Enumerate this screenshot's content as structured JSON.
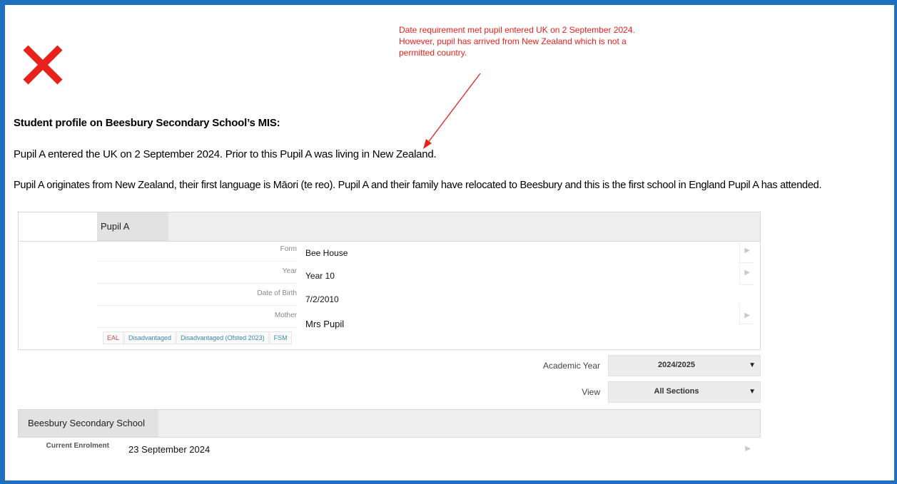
{
  "annotation": {
    "lines": [
      "Date requirement met pupil entered UK on 2 September 2024.",
      "However, pupil has arrived from New Zealand which is not a",
      "permitted country."
    ]
  },
  "icons": {
    "mark": "cross-icon",
    "row_arrow": "chevron-right-icon",
    "dropdown": "caret-down-icon"
  },
  "colors": {
    "cross": "#e8211d",
    "frame": "#1f6fbf",
    "annotation": "#e8211d"
  },
  "heading": "Student profile on Beesbury Secondary School’s MIS:",
  "paragraphs": [
    "Pupil A entered the UK on 2 September 2024. Prior to this Pupil A was living in New Zealand.",
    "Pupil A originates from New Zealand, their first language is Māori (te reo). Pupil A and their family have relocated to Beesbury and this is the first school in England Pupil A has attended."
  ],
  "profile": {
    "name": "Pupil A",
    "fields": [
      {
        "label": "Form",
        "value": "Bee House"
      },
      {
        "label": "Year",
        "value": "Year 10"
      },
      {
        "label": "Date of Birth",
        "value": "7/2/2010"
      },
      {
        "label": "Mother",
        "value": "Mrs Pupil"
      }
    ],
    "tags": [
      "EAL",
      "Disadvantaged",
      "Disadvantaged (Ofsted 2023)",
      "FSM"
    ]
  },
  "filters": {
    "academic_year_label": "Academic Year",
    "academic_year_value": "2024/2025",
    "view_label": "View",
    "view_value": "All Sections"
  },
  "school": {
    "name": "Beesbury Secondary School",
    "enrolment_label": "Current Enrolment",
    "enrolment_value": "23 September 2024"
  }
}
